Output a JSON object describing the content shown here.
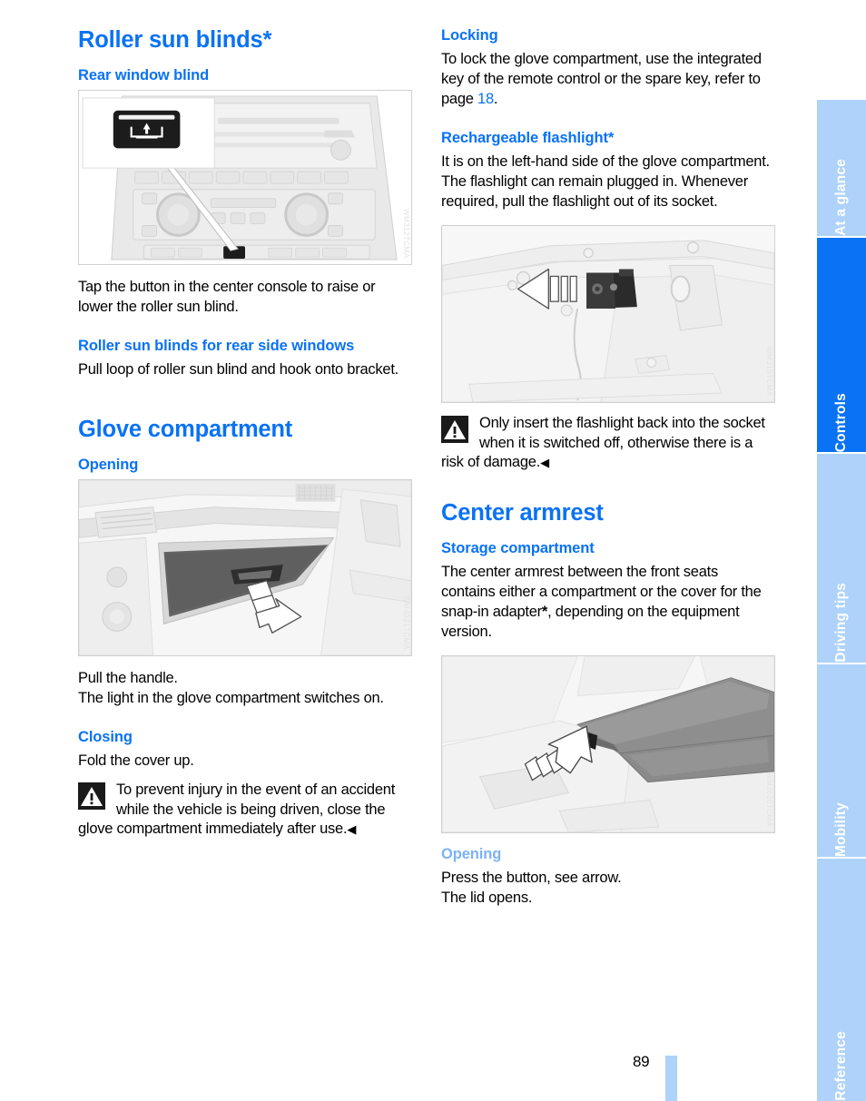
{
  "page": {
    "number": "89"
  },
  "rail": {
    "tabs": [
      {
        "label": "At a glance",
        "active": false
      },
      {
        "label": "Controls",
        "active": true
      },
      {
        "label": "Driving tips",
        "active": false
      },
      {
        "label": "Mobility",
        "active": false
      },
      {
        "label": "Reference",
        "active": false
      }
    ]
  },
  "left_column": {
    "section_title": "Roller sun blinds*",
    "rear_window_blind": {
      "heading": "Rear window blind",
      "figure_caption": "WM312TCMA",
      "body": "Tap the button in the center console to raise or lower the roller sun blind."
    },
    "rear_side_windows": {
      "heading": "Roller sun blinds for rear side windows",
      "body": "Pull loop of roller sun blind and hook onto bracket."
    },
    "glove_compartment": {
      "section_title": "Glove compartment",
      "opening": {
        "heading": "Opening",
        "figure_caption": "WM4021TCMA",
        "body_line1": "Pull the handle.",
        "body_line2": "The light in the glove compartment switches on."
      },
      "closing": {
        "heading": "Closing",
        "body": "Fold the cover up.",
        "warning": "To prevent injury in the event of an accident while the vehicle is being driven, close the glove compartment immediately after use.",
        "warning_endmark": "◀"
      }
    }
  },
  "right_column": {
    "locking": {
      "heading": "Locking",
      "body_before": "To lock the glove compartment, use the integrated key of the remote control or the spare key, refer to page ",
      "page_ref": "18",
      "body_after": "."
    },
    "rechargeable_flashlight": {
      "heading": "Rechargeable flashlight*",
      "body": "It is on the left-hand side of the glove compartment. The flashlight can remain plugged in. Whenever required, pull the flashlight out of its socket.",
      "figure_caption": "WM319TCMA",
      "warning": "Only insert the flashlight back into the socket when it is switched off, otherwise there is a risk of damage.",
      "warning_endmark": "◀"
    },
    "center_armrest": {
      "section_title": "Center armrest",
      "storage_compartment": {
        "heading": "Storage compartment",
        "body_before": "The center armrest between the front seats contains either a compartment or the cover for the snap-in adapter",
        "star": "*",
        "body_after": ", depending on the equipment version.",
        "figure_caption": "WM2620TCMA"
      },
      "opening": {
        "heading": "Opening",
        "body_line1": "Press the button, see arrow.",
        "body_line2": "The lid opens."
      }
    }
  },
  "colors": {
    "accent_blue": "#0a72f5",
    "pale_blue": "#aed2fa",
    "muted_heading_blue": "#7db2f7"
  }
}
